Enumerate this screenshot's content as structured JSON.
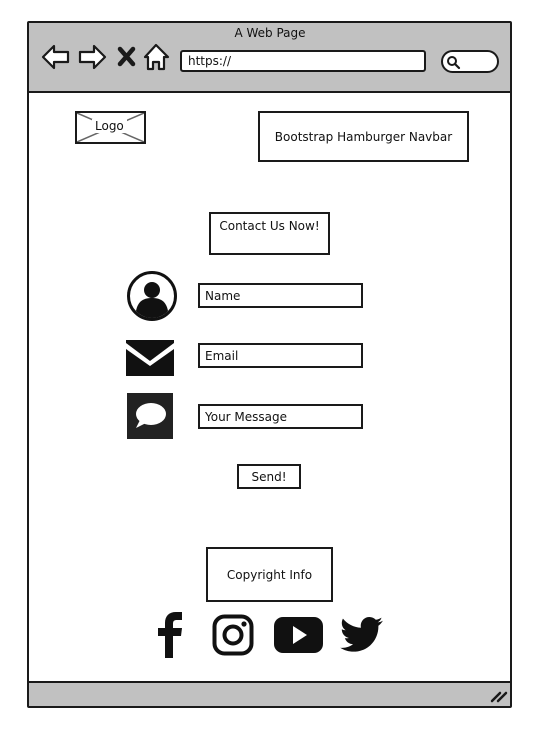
{
  "browser": {
    "title": "A Web Page",
    "url": "https://"
  },
  "header": {
    "logo_label": "Logo",
    "navbar_label": "Bootstrap Hamburger Navbar"
  },
  "contact": {
    "heading": "Contact Us Now!",
    "name_placeholder": "Name",
    "email_placeholder": "Email",
    "message_placeholder": "Your Message",
    "send_label": "Send!"
  },
  "footer": {
    "copyright": "Copyright Info",
    "social_icons": [
      "facebook-icon",
      "instagram-icon",
      "youtube-icon",
      "twitter-icon"
    ]
  },
  "colors": {
    "chrome": "#c1c1c1",
    "stroke": "#1a1a1a",
    "background": "#ffffff"
  }
}
